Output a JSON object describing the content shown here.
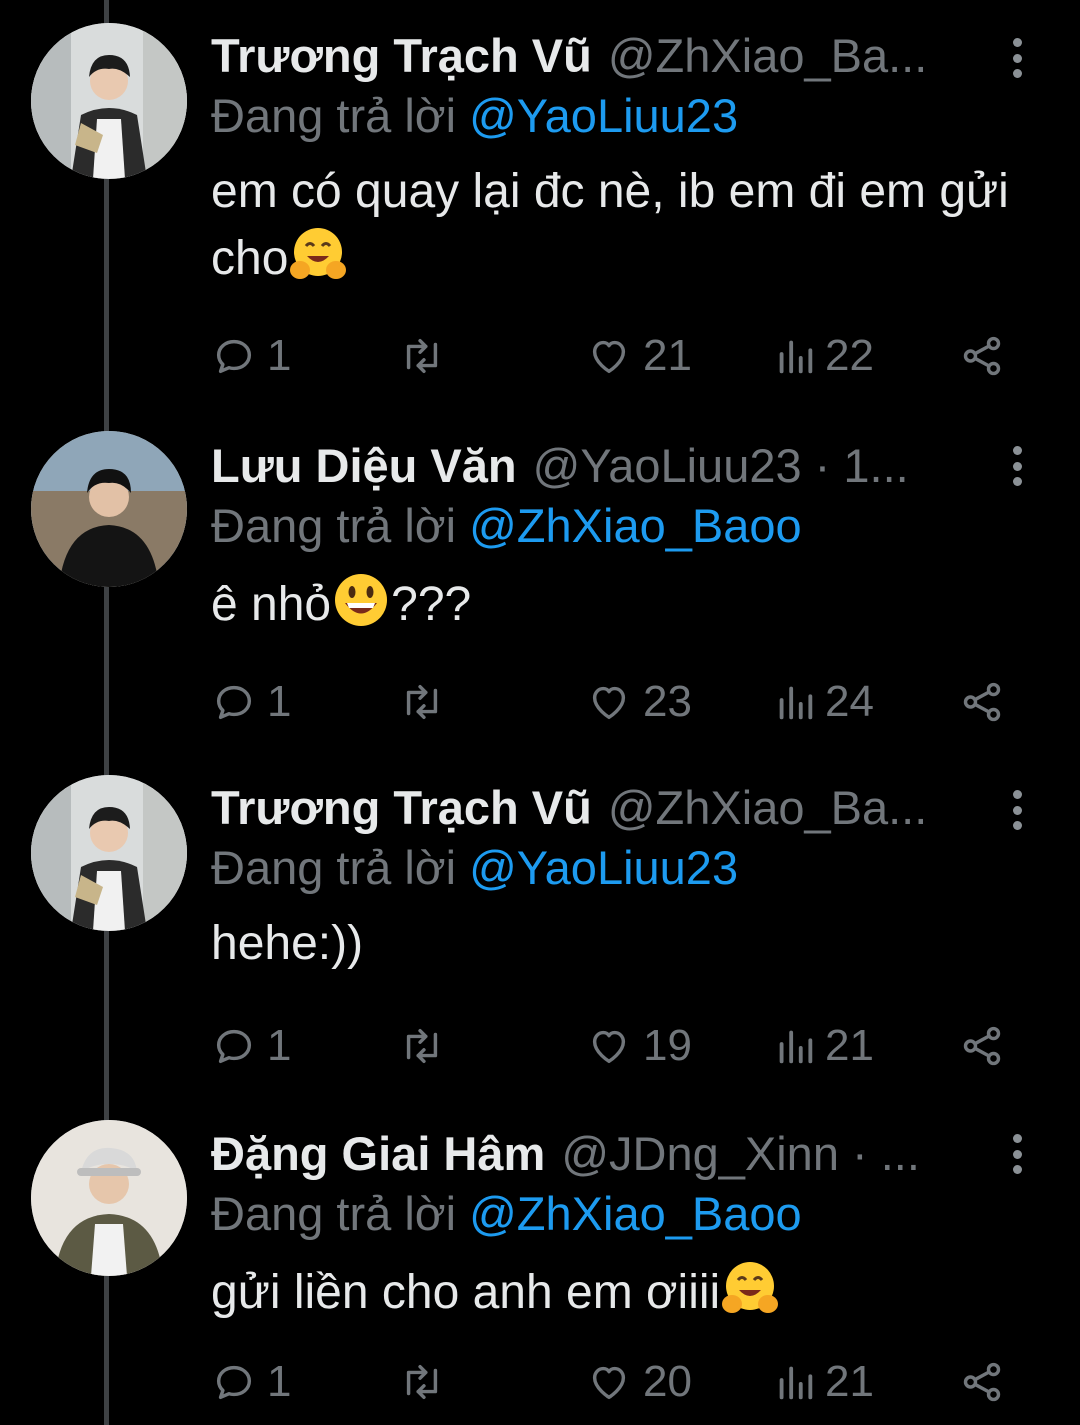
{
  "tweets": [
    {
      "display_name": "Trương Trạch Vũ",
      "handle_meta": "@ZhXiao_Ba...",
      "replying_prefix": "Đang trả lời ",
      "replying_to": "@YaoLiuu23",
      "body": "em có quay lại đc nè, ib em đi em gửi cho",
      "emoji": "hugging-face",
      "stats": {
        "replies": "1",
        "likes": "21",
        "views": "22"
      }
    },
    {
      "display_name": "Lưu Diệu Văn",
      "handle_meta": "@YaoLiuu23 · 1...",
      "replying_prefix": "Đang trả lời ",
      "replying_to": "@ZhXiao_Baoo",
      "body": "ê nhỏ",
      "body_suffix": "???",
      "emoji": "smiling-face",
      "stats": {
        "replies": "1",
        "likes": "23",
        "views": "24"
      }
    },
    {
      "display_name": "Trương Trạch Vũ",
      "handle_meta": "@ZhXiao_Ba...",
      "replying_prefix": "Đang trả lời ",
      "replying_to": "@YaoLiuu23",
      "body": "hehe:))",
      "stats": {
        "replies": "1",
        "likes": "19",
        "views": "21"
      }
    },
    {
      "display_name": "Đặng Giai Hâm",
      "handle_meta": "@JDng_Xinn · ...",
      "replying_prefix": "Đang trả lời ",
      "replying_to": "@ZhXiao_Baoo",
      "body": "gửi liền cho anh em ơiiii",
      "emoji": "hugging-face",
      "stats": {
        "replies": "1",
        "likes": "20",
        "views": "21"
      }
    }
  ],
  "colors": {
    "background": "#000000",
    "primary_text": "#e7e9ea",
    "secondary_text": "#71767b",
    "link": "#1d9bf0",
    "thread_line": "#3e4144",
    "emoji_yellow": "#ffcc33"
  },
  "icons": [
    "reply-icon",
    "retweet-icon",
    "like-icon",
    "views-icon",
    "share-icon",
    "more-icon"
  ]
}
